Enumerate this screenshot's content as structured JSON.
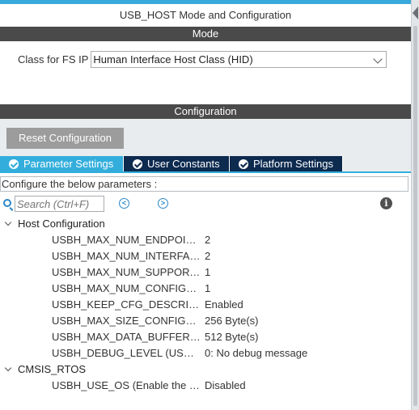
{
  "window": {
    "title": "USB_HOST Mode and Configuration"
  },
  "mode": {
    "header": "Mode",
    "class_label": "Class for FS IP",
    "class_value": "Human Interface Host Class (HID)"
  },
  "configuration": {
    "header": "Configuration",
    "reset_label": "Reset Configuration",
    "tabs": [
      {
        "label": "Parameter Settings",
        "active": true
      },
      {
        "label": "User Constants",
        "active": false
      },
      {
        "label": "Platform Settings",
        "active": false
      }
    ],
    "configure_text": "Configure the below parameters :",
    "search": {
      "placeholder": "Search (Ctrl+F)"
    },
    "groups": [
      {
        "name": "Host Configuration",
        "params": [
          {
            "name": "USBH_MAX_NUM_ENDPOINTS",
            "value": "2"
          },
          {
            "name": "USBH_MAX_NUM_INTERFACES",
            "value": "2"
          },
          {
            "name": "USBH_MAX_NUM_SUPPORTED_CLASS",
            "value": "1"
          },
          {
            "name": "USBH_MAX_NUM_CONFIGURATION",
            "value": "1"
          },
          {
            "name": "USBH_KEEP_CFG_DESCRIPTOR",
            "value": "Enabled"
          },
          {
            "name": "USBH_MAX_SIZE_CONFIGURATION",
            "value": "256 Byte(s)"
          },
          {
            "name": "USBH_MAX_DATA_BUFFER (Max size Data Buffer)",
            "value": "512 Byte(s)"
          },
          {
            "name": "USBH_DEBUG_LEVEL (USBH Debug Level)",
            "value": "0: No debug message"
          }
        ]
      },
      {
        "name": "CMSIS_RTOS",
        "params": [
          {
            "name": "USBH_USE_OS (Enable the support of an RTOS)",
            "value": "Disabled"
          }
        ]
      }
    ]
  },
  "colors": {
    "accent": "#33aedc",
    "tab_dark": "#0d2a4f",
    "section_header": "#4a4a4a",
    "reset_button": "#9c9c9c",
    "link_blue": "#2a86c8"
  }
}
